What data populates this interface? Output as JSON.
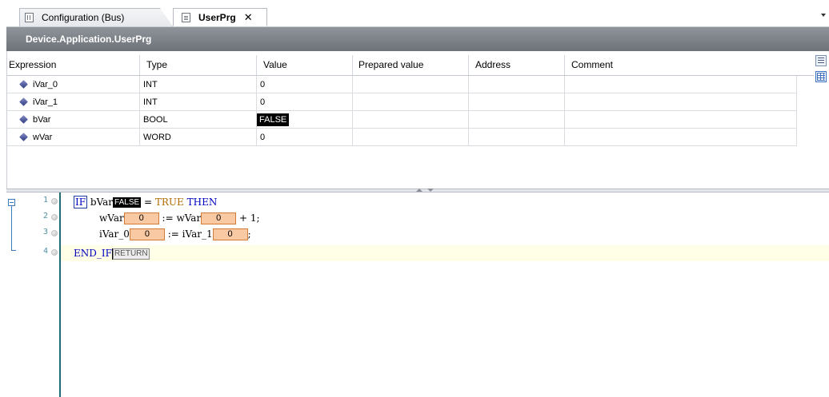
{
  "tabs": [
    {
      "label": "Configuration (Bus)",
      "icon": "grid-document-icon",
      "active": false
    },
    {
      "label": "UserPrg",
      "icon": "document-icon",
      "active": true,
      "close": "✕"
    }
  ],
  "path": "Device.Application.UserPrg",
  "watch": {
    "columns": [
      "Expression",
      "Type",
      "Value",
      "Prepared value",
      "Address",
      "Comment"
    ],
    "rows": [
      {
        "expression": "iVar_0",
        "type": "INT",
        "value": "0",
        "prepared": "",
        "address": "",
        "comment": ""
      },
      {
        "expression": "iVar_1",
        "type": "INT",
        "value": "0",
        "prepared": "",
        "address": "",
        "comment": ""
      },
      {
        "expression": "bVar",
        "type": "BOOL",
        "value": "FALSE",
        "prepared": "",
        "address": "",
        "comment": ""
      },
      {
        "expression": "wVar",
        "type": "WORD",
        "value": "0",
        "prepared": "",
        "address": "",
        "comment": ""
      }
    ]
  },
  "editor": {
    "line_numbers": [
      "1",
      "2",
      "3",
      "4"
    ],
    "line1": {
      "kw_if": "IF",
      "var": "bVar",
      "inline": "FALSE",
      "rest_op": " = ",
      "lit": "TRUE",
      "kw_then": "THEN"
    },
    "line2": {
      "var1": "wVar",
      "inline1": "0",
      "op": " := ",
      "var2": "wVar",
      "inline2": "0",
      "tail": " + 1;"
    },
    "line3": {
      "var1": "iVar_0",
      "inline1": "0",
      "op": " := ",
      "var2": "iVar_1",
      "inline2": "0",
      "tail": ";"
    },
    "line4": {
      "kw": "END_IF",
      "inline": "RETURN"
    }
  },
  "colors": {
    "keyword": "#0000c0",
    "literal": "#b06c00",
    "inline_value_bg": "#f9c9a4",
    "header_band": "#6e737a"
  }
}
